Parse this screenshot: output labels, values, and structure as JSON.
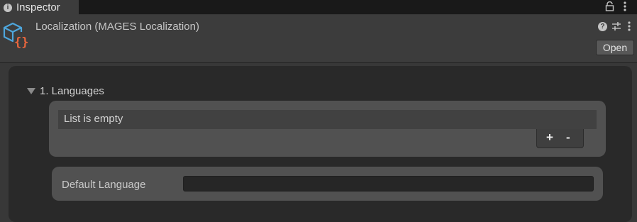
{
  "tab": {
    "label": "Inspector",
    "icon": "info-icon"
  },
  "tab_actions": {
    "lock_icon": "lock-icon",
    "menu_icon": "kebab-menu-icon"
  },
  "component": {
    "title": "Localization (MAGES Localization)",
    "icon": "script-component-icon",
    "help_icon": "help-icon",
    "preset_icon": "preset-icon",
    "menu_icon": "kebab-menu-icon",
    "open_label": "Open"
  },
  "languages_section": {
    "label": "1. Languages",
    "expanded": true,
    "empty_text": "List is empty",
    "add_label": "+",
    "remove_label": "-"
  },
  "default_language": {
    "label": "Default Language",
    "value": ""
  },
  "colors": {
    "background": "#383838",
    "panel": "#292929",
    "card": "#515151",
    "icon_blue": "#4ea6dc",
    "icon_orange": "#e8663d"
  }
}
